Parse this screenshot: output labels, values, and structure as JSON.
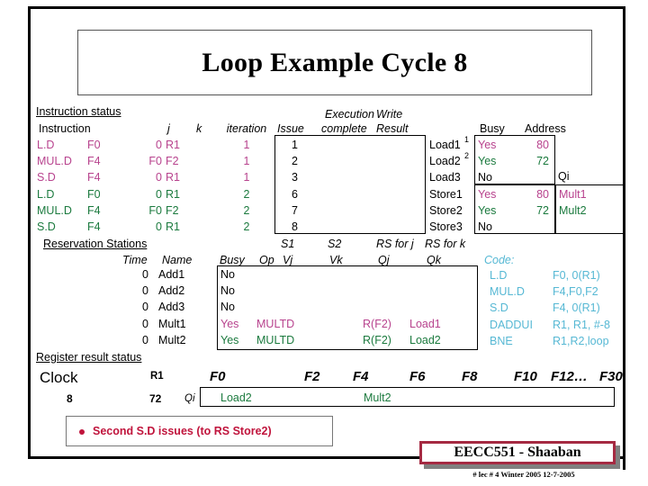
{
  "slide": {
    "title": "Loop Example Cycle 8"
  },
  "instruction_status": {
    "section_label": "Instruction status",
    "headers": {
      "instruction": "Instruction",
      "j": "j",
      "k": "k",
      "iteration": "iteration",
      "issue": "Issue",
      "execution": "Execution",
      "complete": "complete",
      "write": "Write",
      "result": "Result"
    },
    "rows": [
      {
        "instruction": "L.D",
        "dest": "F0",
        "j": "0",
        "k": "R1",
        "iteration": "1",
        "issue": "1",
        "exec_complete": "",
        "write_result": "",
        "color": "mag"
      },
      {
        "instruction": "MUL.D",
        "dest": "F4",
        "j": "F0",
        "k": "F2",
        "iteration": "1",
        "issue": "2",
        "exec_complete": "",
        "write_result": "",
        "color": "mag"
      },
      {
        "instruction": "S.D",
        "dest": "F4",
        "j": "0",
        "k": "R1",
        "iteration": "1",
        "issue": "3",
        "exec_complete": "",
        "write_result": "",
        "color": "mag"
      },
      {
        "instruction": "L.D",
        "dest": "F0",
        "j": "0",
        "k": "R1",
        "iteration": "2",
        "issue": "6",
        "exec_complete": "",
        "write_result": "",
        "color": "grn"
      },
      {
        "instruction": "MUL.D",
        "dest": "F4",
        "j": "F0",
        "k": "F2",
        "iteration": "2",
        "issue": "7",
        "exec_complete": "",
        "write_result": "",
        "color": "grn"
      },
      {
        "instruction": "S.D",
        "dest": "F4",
        "j": "0",
        "k": "R1",
        "iteration": "2",
        "issue": "8",
        "exec_complete": "",
        "write_result": "",
        "color": "grn"
      }
    ]
  },
  "load_store_buffers": {
    "headers": {
      "busy": "Busy",
      "address": "Address",
      "qi": "Qi"
    },
    "rows": [
      {
        "name": "Load1",
        "superscript": "1",
        "busy": "Yes",
        "address": "80",
        "qi": "",
        "color": "mag"
      },
      {
        "name": "Load2",
        "superscript": "2",
        "busy": "Yes",
        "address": "72",
        "qi": "",
        "color": "grn"
      },
      {
        "name": "Load3",
        "superscript": "",
        "busy": "No",
        "address": "",
        "qi": "",
        "color": "blk"
      },
      {
        "name": "Store1",
        "superscript": "",
        "busy": "Yes",
        "address": "80",
        "qi": "Mult1",
        "color": "mag"
      },
      {
        "name": "Store2",
        "superscript": "",
        "busy": "Yes",
        "address": "72",
        "qi": "Mult2",
        "color": "grn"
      },
      {
        "name": "Store3",
        "superscript": "",
        "busy": "No",
        "address": "",
        "qi": "",
        "color": "blk"
      }
    ]
  },
  "reservation_stations": {
    "section_label": "Reservation Stations",
    "headers": {
      "time": "Time",
      "name": "Name",
      "busy": "Busy",
      "op": "Op",
      "s1": "S1",
      "s2": "S2",
      "vj": "Vj",
      "vk": "Vk",
      "rs_for_j": "RS for j",
      "rs_for_k": "RS for k",
      "qj": "Qj",
      "qk": "Qk"
    },
    "rows": [
      {
        "time": "0",
        "name": "Add1",
        "busy": "No",
        "op": "",
        "vj": "",
        "vk": "",
        "qj": "",
        "qk": "",
        "color": "blk"
      },
      {
        "time": "0",
        "name": "Add2",
        "busy": "No",
        "op": "",
        "vj": "",
        "vk": "",
        "qj": "",
        "qk": "",
        "color": "blk"
      },
      {
        "time": "0",
        "name": "Add3",
        "busy": "No",
        "op": "",
        "vj": "",
        "vk": "",
        "qj": "",
        "qk": "",
        "color": "blk"
      },
      {
        "time": "0",
        "name": "Mult1",
        "busy": "Yes",
        "op": "MULTD",
        "vj": "",
        "vk": "R(F2)",
        "qj": "Load1",
        "qk": "",
        "color": "mag"
      },
      {
        "time": "0",
        "name": "Mult2",
        "busy": "Yes",
        "op": "MULTD",
        "vj": "",
        "vk": "R(F2)",
        "qj": "Load2",
        "qk": "",
        "color": "grn"
      }
    ]
  },
  "code": {
    "label": "Code:",
    "lines": [
      {
        "op": "L.D",
        "args": "F0, 0(R1)"
      },
      {
        "op": "MUL.D",
        "args": "F4,F0,F2"
      },
      {
        "op": "S.D",
        "args": "F4, 0(R1)"
      },
      {
        "op": "DADDUI",
        "args": "R1, R1, #-8"
      },
      {
        "op": "BNE",
        "args": "R1,R2,loop"
      }
    ]
  },
  "register_result_status": {
    "section_label": "Register result status",
    "clock_label": "Clock",
    "clock_value": "8",
    "r1_label": "R1",
    "r1_value": "72",
    "qi_label": "Qi",
    "registers": [
      "F0",
      "F2",
      "F4",
      "F6",
      "F8",
      "F10",
      "F12…",
      "F30"
    ],
    "values": [
      {
        "reg": "F0",
        "value": "Load2",
        "color": "grn"
      },
      {
        "reg": "F4",
        "value": "Mult2",
        "color": "grn"
      }
    ]
  },
  "note": {
    "text": "Second S.D issues  (to RS Store2)"
  },
  "footer": {
    "course": "EECC551 - Shaaban",
    "meta": "#  lec # 4  Winter 2005   12-7-2005"
  },
  "colors": {
    "magenta": "#b8438e",
    "green": "#1b7a3e",
    "cyan": "#56b8d4",
    "crimson": "#c0143c",
    "footer_border": "#a52a42"
  }
}
